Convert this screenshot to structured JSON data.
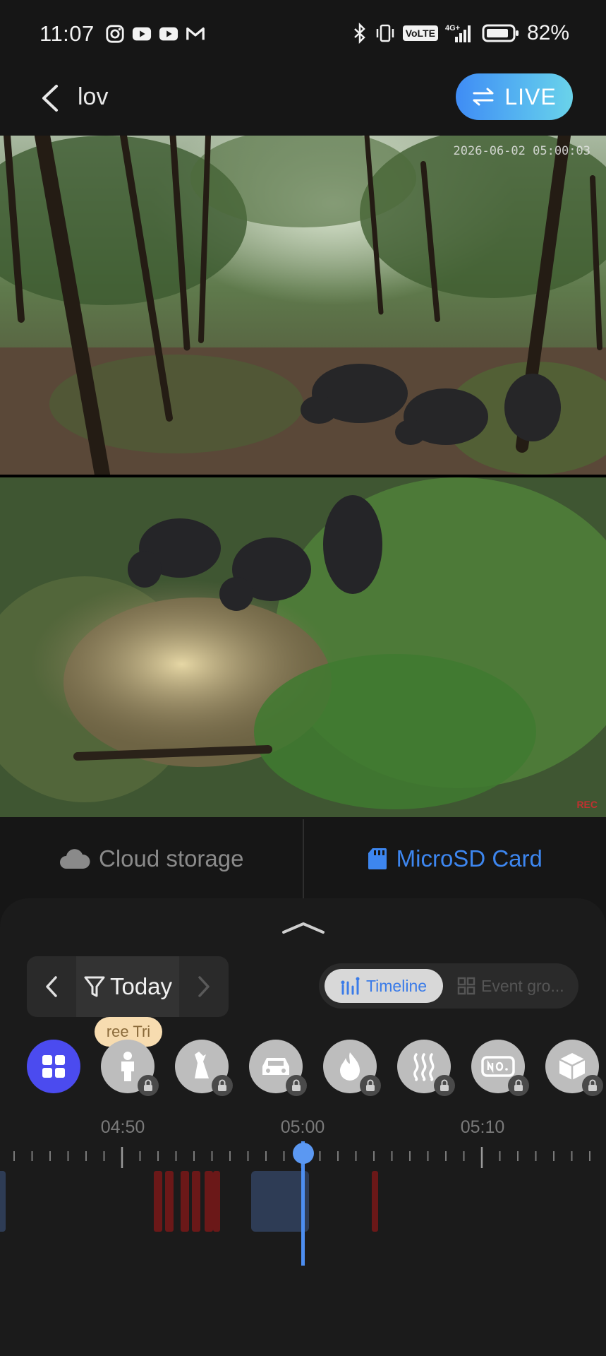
{
  "status_bar": {
    "time": "11:07",
    "left_icons": [
      "instagram-icon",
      "youtube-icon",
      "youtube-icon",
      "gmail-icon"
    ],
    "right_icons": [
      "bluetooth-icon",
      "vibrate-icon",
      "volte-icon",
      "signal-4g-icon",
      "battery-icon"
    ],
    "volte_label": "VoLTE",
    "network_label": "4G+",
    "battery": "82%"
  },
  "header": {
    "title": "lov",
    "live_label": "LIVE"
  },
  "video": {
    "timestamp": "2026-06-02 05:00:03",
    "corner_mark": "REC"
  },
  "storage_tabs": {
    "cloud_label": "Cloud storage",
    "sd_label": "MicroSD Card",
    "selected": "MicroSD Card"
  },
  "date_nav": {
    "label": "Today"
  },
  "view_toggle": {
    "timeline_label": "Timeline",
    "event_label": "Event gro..."
  },
  "tooltip": {
    "text": "ree Tri"
  },
  "filters": [
    {
      "name": "all-events",
      "icon": "grid-icon",
      "locked": false,
      "selected": true
    },
    {
      "name": "person",
      "icon": "person-icon",
      "locked": true
    },
    {
      "name": "pet",
      "icon": "dog-icon",
      "locked": true
    },
    {
      "name": "vehicle",
      "icon": "car-icon",
      "locked": true
    },
    {
      "name": "fire",
      "icon": "flame-icon",
      "locked": true
    },
    {
      "name": "heat",
      "icon": "heat-waves-icon",
      "locked": true
    },
    {
      "name": "license-plate",
      "icon": "plate-icon",
      "locked": true
    },
    {
      "name": "package",
      "icon": "package-icon",
      "locked": true
    }
  ],
  "timeline": {
    "labels": [
      "04:50",
      "05:00",
      "05:10"
    ],
    "current_time": "05:00",
    "colors": {
      "accent": "#4d8ef0",
      "event_red": "#6b1818",
      "event_blue": "#2e3c55"
    }
  }
}
